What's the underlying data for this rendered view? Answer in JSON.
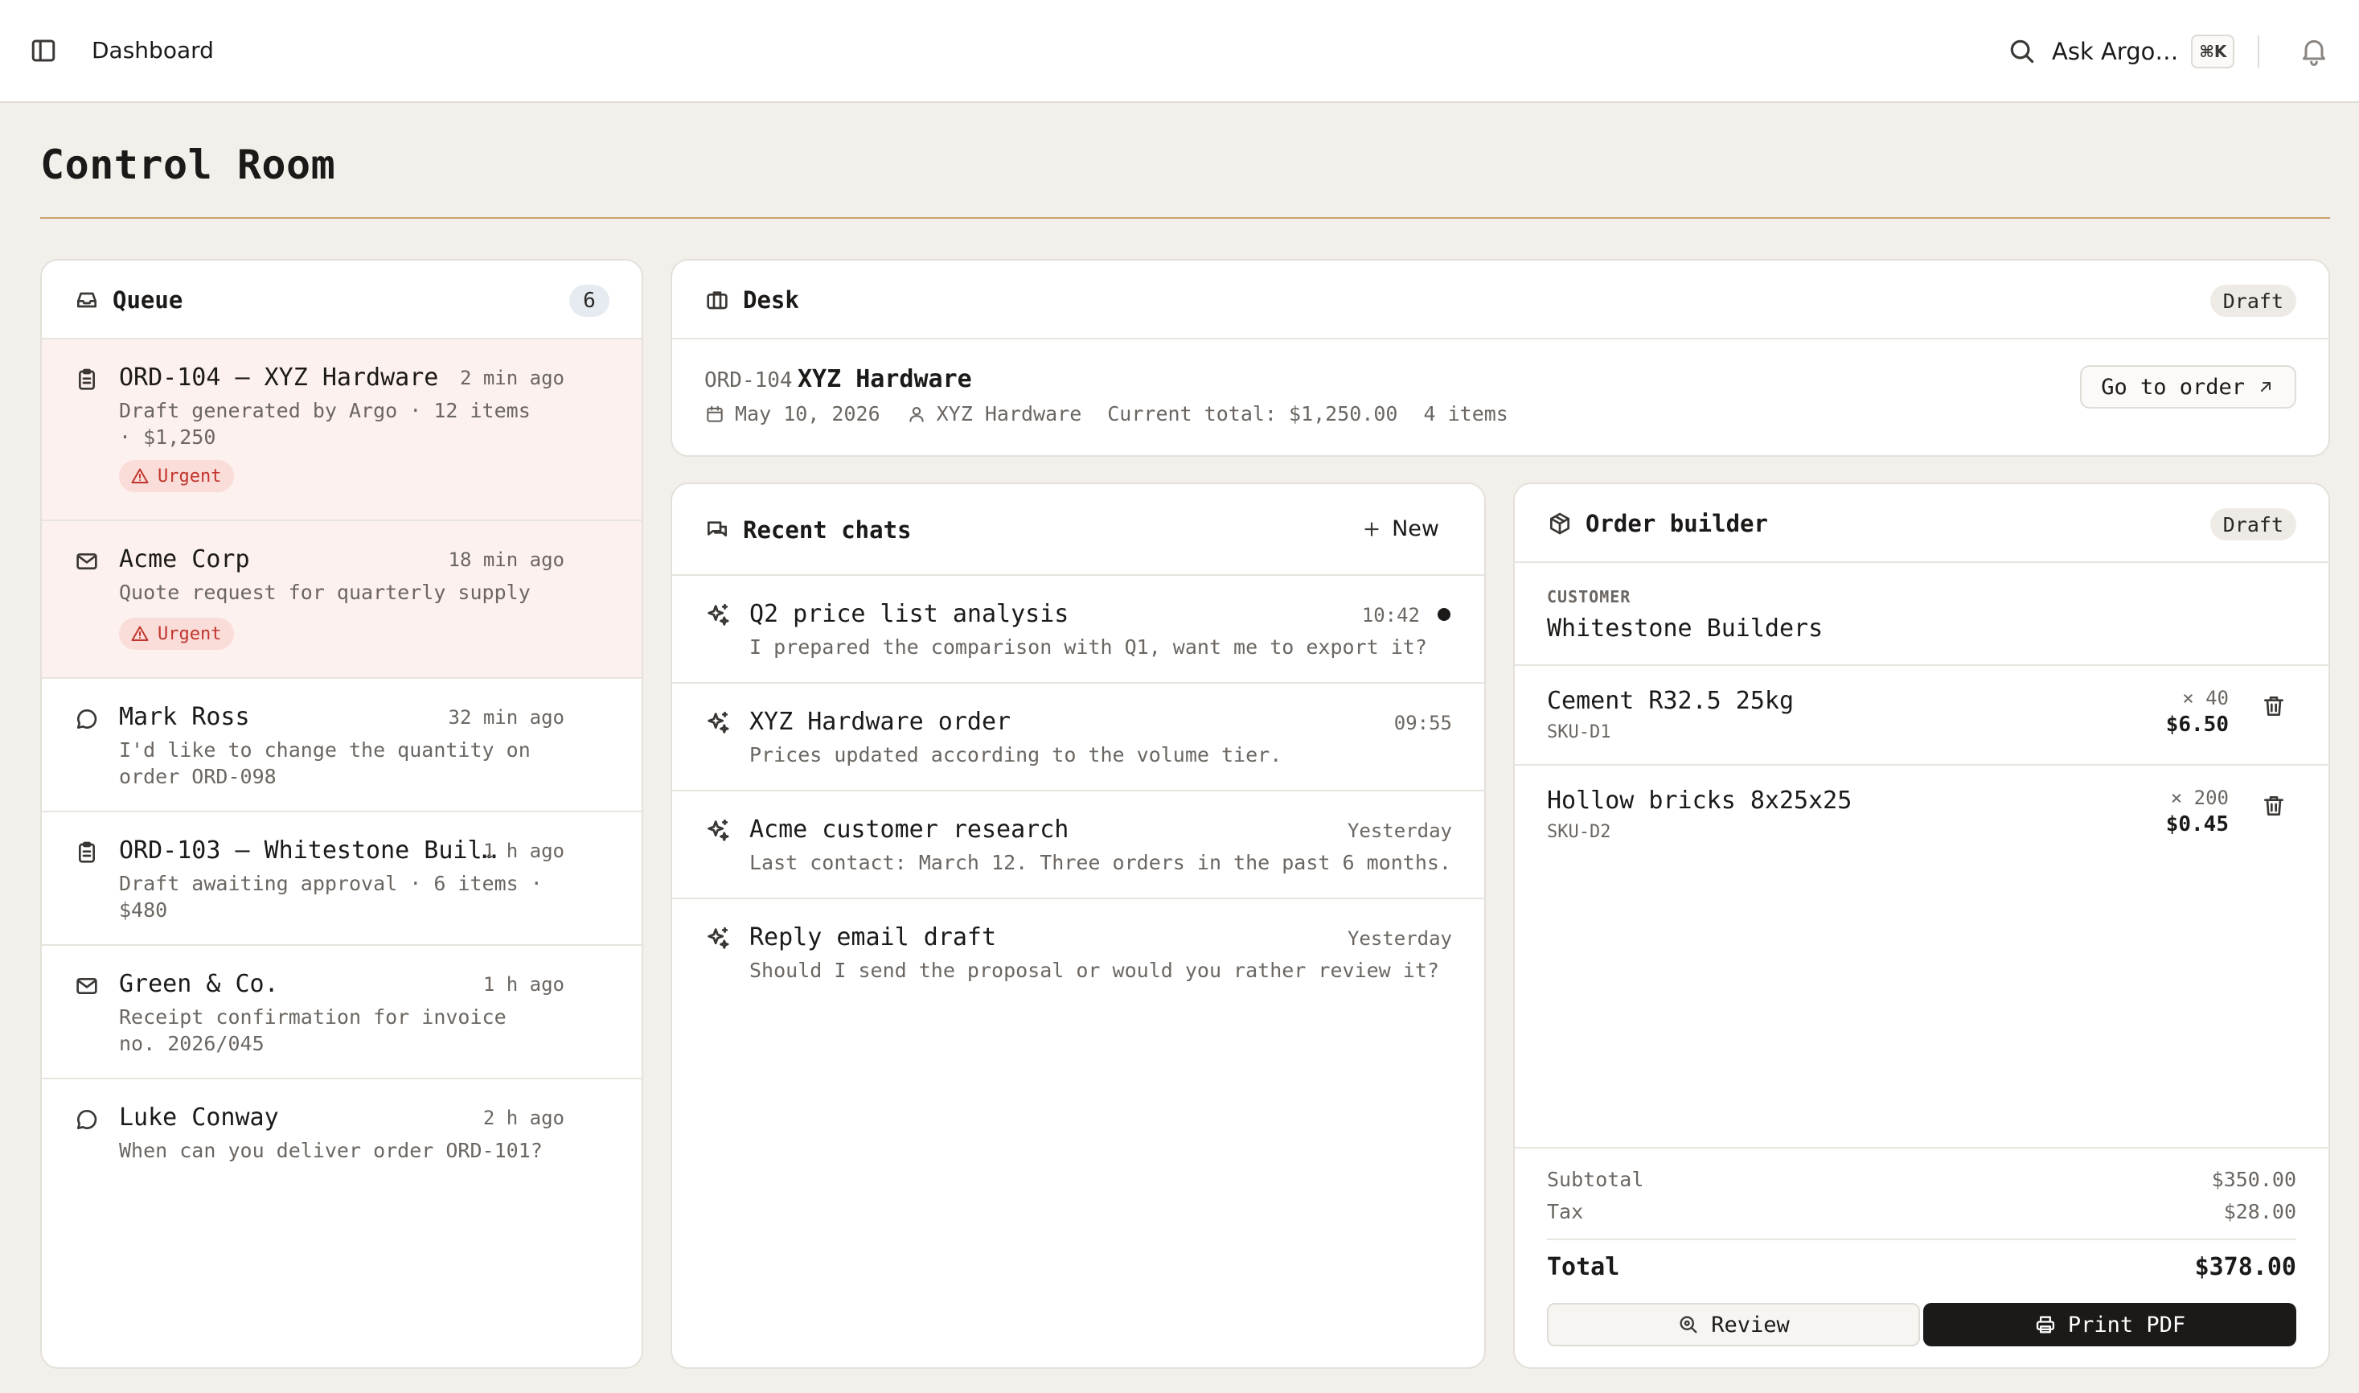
{
  "topbar": {
    "breadcrumb": "Dashboard",
    "ask_label": "Ask Argo…",
    "shortcut": "⌘K"
  },
  "page": {
    "title": "Control Room"
  },
  "queue": {
    "title": "Queue",
    "count": "6",
    "urgent_label": "Urgent",
    "items": [
      {
        "icon": "clipboard-icon",
        "title": "ORD-104 — XYZ Hardware",
        "time": "2 min ago",
        "desc": "Draft generated by Argo · 12 items · $1,250",
        "urgent": true
      },
      {
        "icon": "mail-icon",
        "title": "Acme Corp",
        "time": "18 min ago",
        "desc": "Quote request for quarterly supply",
        "urgent": true
      },
      {
        "icon": "chat-icon",
        "title": "Mark Ross",
        "time": "32 min ago",
        "desc": "I'd like to change the quantity on order ORD-098",
        "urgent": false
      },
      {
        "icon": "clipboard-icon",
        "title": "ORD-103 — Whitestone Buil…",
        "time": "1 h ago",
        "desc": "Draft awaiting approval · 6 items · $480",
        "urgent": false
      },
      {
        "icon": "mail-icon",
        "title": "Green & Co.",
        "time": "1 h ago",
        "desc": "Receipt confirmation for invoice no. 2026/045",
        "urgent": false
      },
      {
        "icon": "chat-icon",
        "title": "Luke Conway",
        "time": "2 h ago",
        "desc": "When can you deliver order ORD-101?",
        "urgent": false
      }
    ]
  },
  "desk": {
    "title": "Desk",
    "status": "Draft",
    "order_id": "ORD-104",
    "customer": "XYZ Hardware",
    "date": "May 10, 2026",
    "contact": "XYZ Hardware",
    "total": "Current total: $1,250.00",
    "items": "4 items",
    "goto_label": "Go to order"
  },
  "chats": {
    "title": "Recent chats",
    "new_label": "New",
    "items": [
      {
        "title": "Q2 price list analysis",
        "time": "10:42",
        "desc": "I prepared the comparison with Q1, want me to export it?",
        "unread": true
      },
      {
        "title": "XYZ Hardware order",
        "time": "09:55",
        "desc": "Prices updated according to the volume tier.",
        "unread": false
      },
      {
        "title": "Acme customer research",
        "time": "Yesterday",
        "desc": "Last contact: March 12. Three orders in the past 6 months.",
        "unread": false
      },
      {
        "title": "Reply email draft",
        "time": "Yesterday",
        "desc": "Should I send the proposal or would you rather review it?",
        "unread": false
      }
    ]
  },
  "order": {
    "title": "Order builder",
    "status": "Draft",
    "customer_label": "CUSTOMER",
    "customer": "Whitestone Builders",
    "lines": [
      {
        "name": "Cement R32.5 25kg",
        "sku": "SKU-D1",
        "qty": "× 40",
        "price": "$6.50"
      },
      {
        "name": "Hollow bricks 8x25x25",
        "sku": "SKU-D2",
        "qty": "× 200",
        "price": "$0.45"
      }
    ],
    "subtotal_label": "Subtotal",
    "subtotal": "$350.00",
    "tax_label": "Tax",
    "tax": "$28.00",
    "total_label": "Total",
    "total": "$378.00",
    "review_label": "Review",
    "print_label": "Print PDF"
  },
  "colors": {
    "background": "#f3f0ec",
    "accent_rule": "#c9a26a",
    "urgent_bg": "#fadcd8",
    "urgent_text": "#c2352d",
    "primary_button": "#1c1a18"
  }
}
